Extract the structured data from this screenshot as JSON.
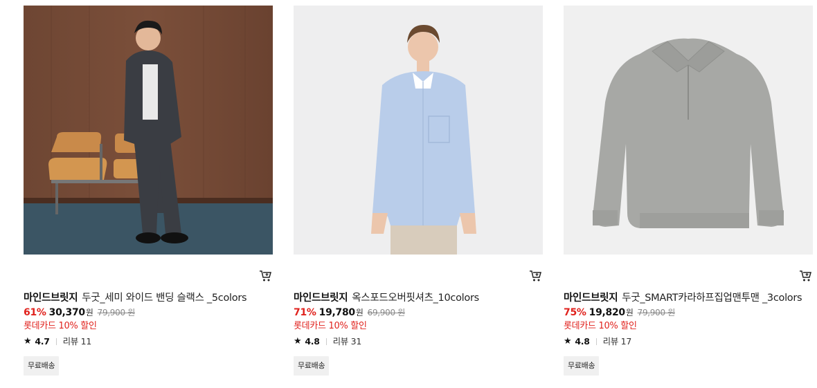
{
  "products": [
    {
      "brand": "마인드브릿지",
      "name": "두굿_세미 와이드 밴딩 슬랙스 _5colors",
      "discount": "61%",
      "price": "30,370",
      "won": "원",
      "original_price": "79,900 원",
      "card_promo": "롯데카드 10% 할인",
      "rating": "4.7",
      "review_label": "리뷰 11",
      "badge": "무료배송",
      "image": "model-in-suit-photo"
    },
    {
      "brand": "마인드브릿지",
      "name": "옥스포드오버핏셔츠_10colors",
      "discount": "71%",
      "price": "19,780",
      "won": "원",
      "original_price": "69,900 원",
      "card_promo": "롯데카드 10% 할인",
      "rating": "4.8",
      "review_label": "리뷰 31",
      "badge": "무료배송",
      "image": "model-in-blue-shirt-photo"
    },
    {
      "brand": "마인드브릿지",
      "name": "두굿_SMART카라하프집업맨투맨 _3colors",
      "discount": "75%",
      "price": "19,820",
      "won": "원",
      "original_price": "79,900 원",
      "card_promo": "롯데카드 10% 할인",
      "rating": "4.8",
      "review_label": "리뷰 17",
      "badge": "무료배송",
      "image": "grey-halfzip-sweatshirt-photo"
    }
  ],
  "colors": {
    "discount": "#e0221d",
    "badge_bg": "#f0f0f0"
  },
  "icons": {
    "cart": "cart-icon",
    "star": "star-icon"
  }
}
